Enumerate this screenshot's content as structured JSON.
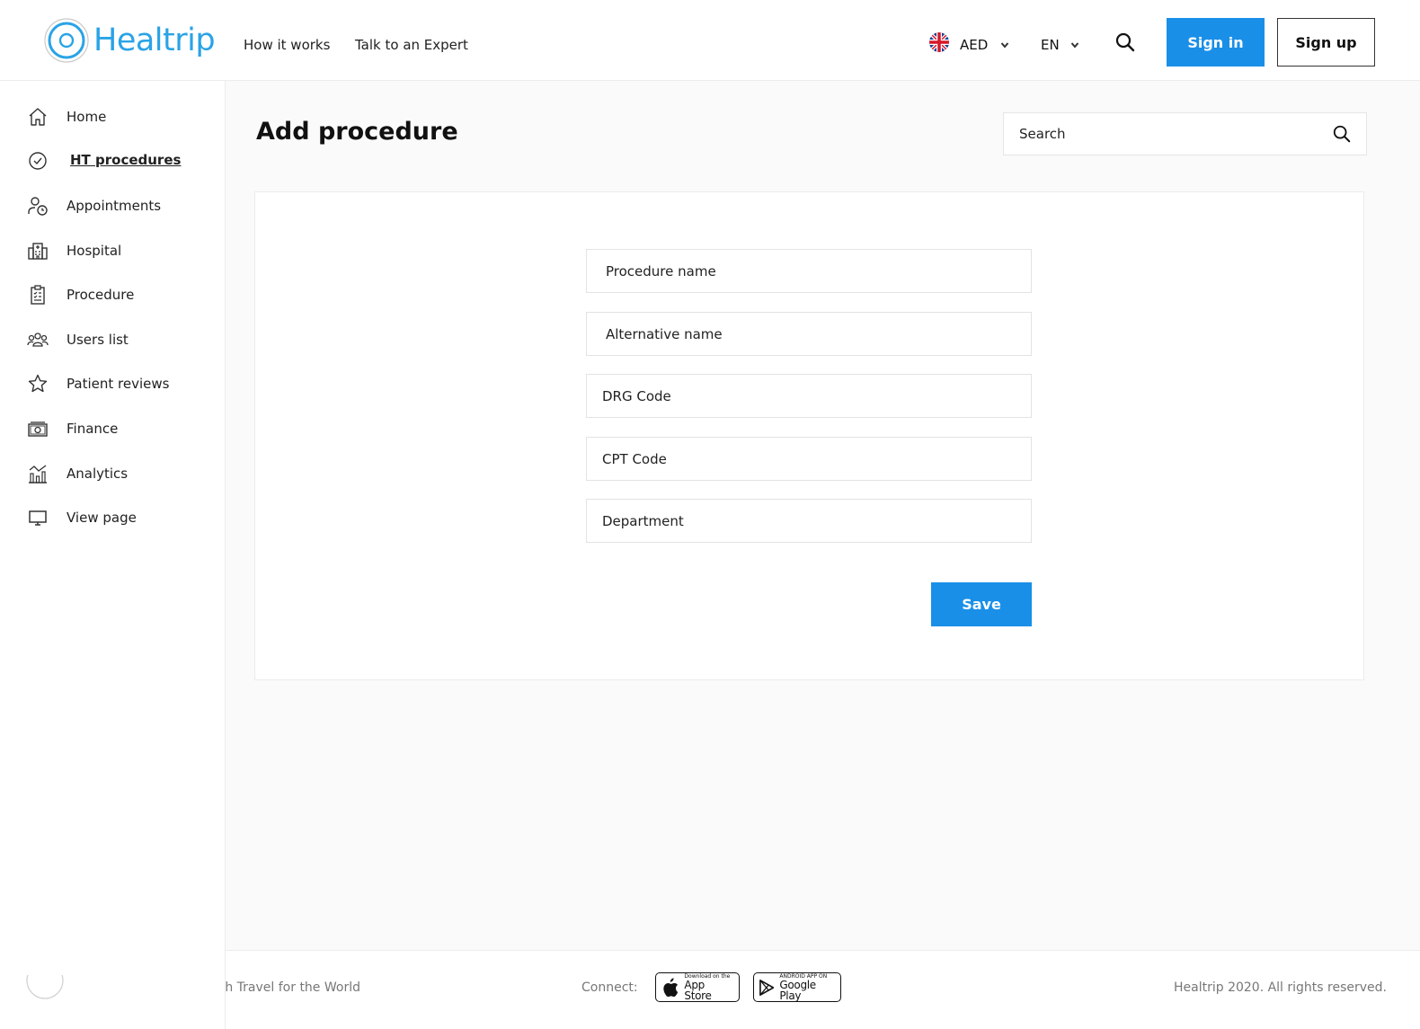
{
  "header": {
    "brand": "Healtrip",
    "nav": [
      {
        "label": "How it works"
      },
      {
        "label": "Talk to an Expert"
      }
    ],
    "currency": "AED",
    "language": "EN",
    "signin_label": "Sign in",
    "signup_label": "Sign up",
    "brand_color": "#2aa3e6",
    "accent_color": "#1a8fe8"
  },
  "sidebar": {
    "items": [
      {
        "label": "Home",
        "icon": "home-icon"
      },
      {
        "label": "HT procedures",
        "icon": "check-circle-icon",
        "active": true
      },
      {
        "label": "Appointments",
        "icon": "user-clock-icon"
      },
      {
        "label": "Hospital",
        "icon": "hospital-icon"
      },
      {
        "label": "Procedure",
        "icon": "clipboard-icon"
      },
      {
        "label": "Users list",
        "icon": "users-icon"
      },
      {
        "label": "Patient reviews",
        "icon": "star-icon"
      },
      {
        "label": "Finance",
        "icon": "money-icon"
      },
      {
        "label": "Analytics",
        "icon": "bar-chart-icon"
      },
      {
        "label": "View page",
        "icon": "monitor-icon"
      }
    ]
  },
  "main": {
    "title": "Add procedure",
    "search": {
      "placeholder": "Search"
    },
    "form": {
      "fields": [
        {
          "placeholder": "Procedure name"
        },
        {
          "placeholder": "Alternative name"
        },
        {
          "placeholder": "DRG Code"
        },
        {
          "placeholder": "CPT Code"
        },
        {
          "placeholder": "Department"
        }
      ],
      "save_label": "Save"
    }
  },
  "footer": {
    "tagline": "Health Travel for the World",
    "connect_label": "Connect:",
    "appstore": {
      "small": "Download on the",
      "big": "App Store"
    },
    "googleplay": {
      "small": "ANDROID APP ON",
      "big": "Google Play"
    },
    "copyright": "Healtrip 2020. All rights reserved."
  }
}
